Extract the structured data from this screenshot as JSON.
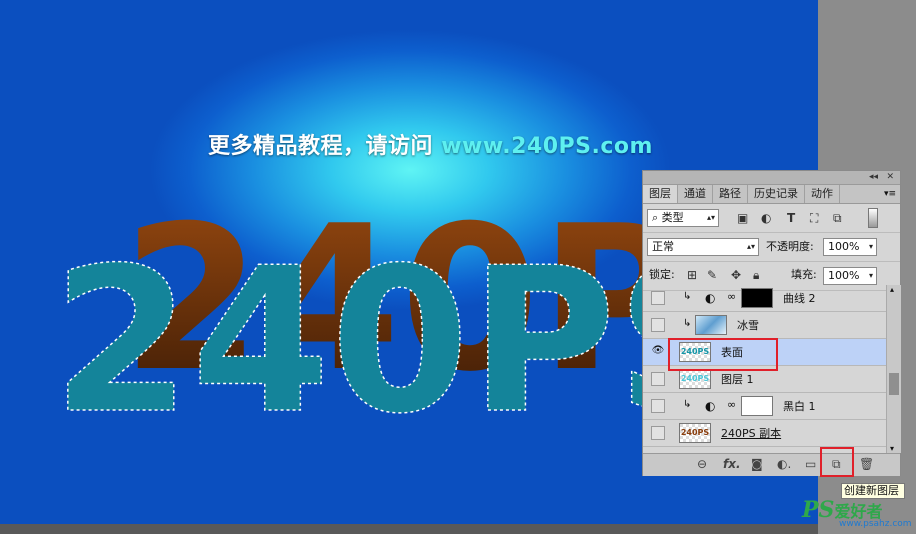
{
  "canvas": {
    "promo_text": "更多精品教程，请访问",
    "promo_url": "www.240PS.com",
    "art_text": "240PS"
  },
  "panel": {
    "tabs": [
      "图层",
      "通道",
      "路径",
      "历史记录",
      "动作"
    ],
    "filter_type": "类型",
    "blend_mode": "正常",
    "opacity_label": "不透明度:",
    "opacity_value": "100%",
    "lock_label": "锁定:",
    "fill_label": "填充:",
    "fill_value": "100%",
    "layers": [
      {
        "name": "曲线 2",
        "visible": false,
        "clipped": true,
        "type": "adjustment"
      },
      {
        "name": "冰雪",
        "visible": false,
        "clipped": true,
        "type": "smart"
      },
      {
        "name": "表面",
        "visible": true,
        "clipped": false,
        "type": "pixel",
        "selected": true
      },
      {
        "name": "图层 1",
        "visible": false,
        "clipped": false,
        "type": "pixel"
      },
      {
        "name": "黑白 1",
        "visible": false,
        "clipped": true,
        "type": "adjustment"
      },
      {
        "name": "240PS 副本",
        "visible": false,
        "clipped": false,
        "type": "pixel"
      }
    ],
    "thumb_text": "240PS"
  },
  "tooltip": "创建新图层",
  "watermark": {
    "logo": "PS",
    "cn": "爱好者",
    "site": "www.psahz.com"
  },
  "colors": {
    "selected_layer": "#bdd2f7",
    "highlight": "#e0202a",
    "art_face": "#14849a",
    "art_side": "#7a3a0c"
  }
}
